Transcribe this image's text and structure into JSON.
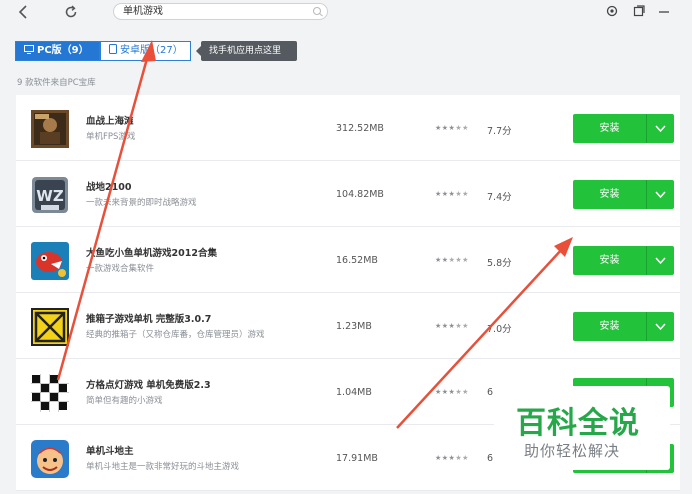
{
  "toolbar": {
    "back_icon": "back-arrow-icon",
    "refresh_icon": "refresh-icon",
    "search_value": "单机游戏"
  },
  "tabs": [
    {
      "label": "PC版（9）",
      "active": true
    },
    {
      "label": "安卓版（27）",
      "active": false
    }
  ],
  "tooltip": "找手机应用点这里",
  "result_count": "9 款软件来自PC宝库",
  "install_label": "安装",
  "apps": [
    {
      "name": "血战上海滩",
      "desc": "单机FPS游戏",
      "size": "312.52MB",
      "stars": 3.5,
      "rating": "7.7分"
    },
    {
      "name": "战地2100",
      "desc": "一款未来背景的即时战略游戏",
      "size": "104.82MB",
      "stars": 3.5,
      "rating": "7.4分"
    },
    {
      "name": "大鱼吃小鱼单机游戏2012合集",
      "desc": "一款游戏合集软件",
      "size": "16.52MB",
      "stars": 2.5,
      "rating": "5.8分"
    },
    {
      "name": "推箱子游戏单机 完整版3.0.7",
      "desc": "经典的推箱子（又称仓库番，仓库管理员）游戏",
      "size": "1.23MB",
      "stars": 3.5,
      "rating": "7.0分"
    },
    {
      "name": "方格点灯游戏 单机免费版2.3",
      "desc": "简单但有趣的小游戏",
      "size": "1.04MB",
      "stars": 3,
      "rating": "6."
    },
    {
      "name": "单机斗地主",
      "desc": "单机斗地主是一款非常好玩的斗地主游戏",
      "size": "17.91MB",
      "stars": 3,
      "rating": "6."
    }
  ],
  "watermark": {
    "title": "百科全说",
    "subtitle": "助你轻松解决"
  },
  "colors": {
    "accent": "#2478d4",
    "install": "#23c23b",
    "arrow": "#e8503a"
  }
}
